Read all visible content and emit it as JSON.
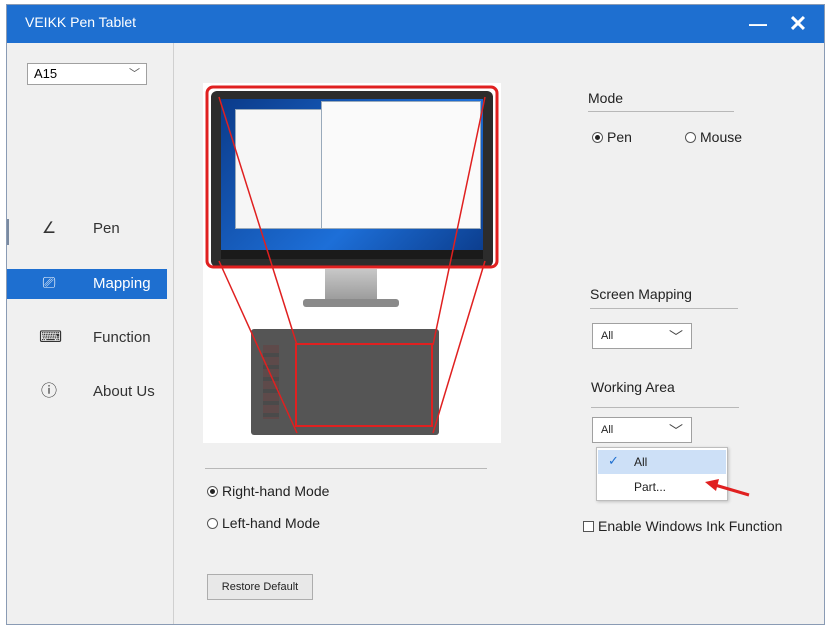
{
  "window": {
    "title": "VEIKK Pen Tablet",
    "minimize_icon": "—",
    "close_icon": "✕"
  },
  "sidebar": {
    "model": "A15",
    "items": [
      {
        "label": "Pen",
        "icon": "pen-icon",
        "glyph": "∠"
      },
      {
        "label": "Mapping",
        "icon": "monitor-icon",
        "glyph": "⎚"
      },
      {
        "label": "Function",
        "icon": "keyboard-icon",
        "glyph": "⌨"
      },
      {
        "label": "About Us",
        "icon": "info-icon",
        "glyph": "ⓘ"
      }
    ],
    "active": "Mapping"
  },
  "mode": {
    "heading": "Mode",
    "options": [
      "Pen",
      "Mouse"
    ],
    "selected": "Pen"
  },
  "screen_mapping": {
    "heading": "Screen Mapping",
    "value": "All"
  },
  "working_area": {
    "heading": "Working Area",
    "value": "All",
    "options": [
      "All",
      "Part..."
    ],
    "selected": "All"
  },
  "hand_mode": {
    "options": [
      "Right-hand Mode",
      "Left-hand Mode"
    ],
    "selected": "Right-hand Mode"
  },
  "windows_ink": {
    "label": "Enable Windows Ink Function",
    "checked": false
  },
  "restore_button": "Restore Default",
  "colors": {
    "accent": "#1e6fd0",
    "highlight": "#e02020"
  }
}
